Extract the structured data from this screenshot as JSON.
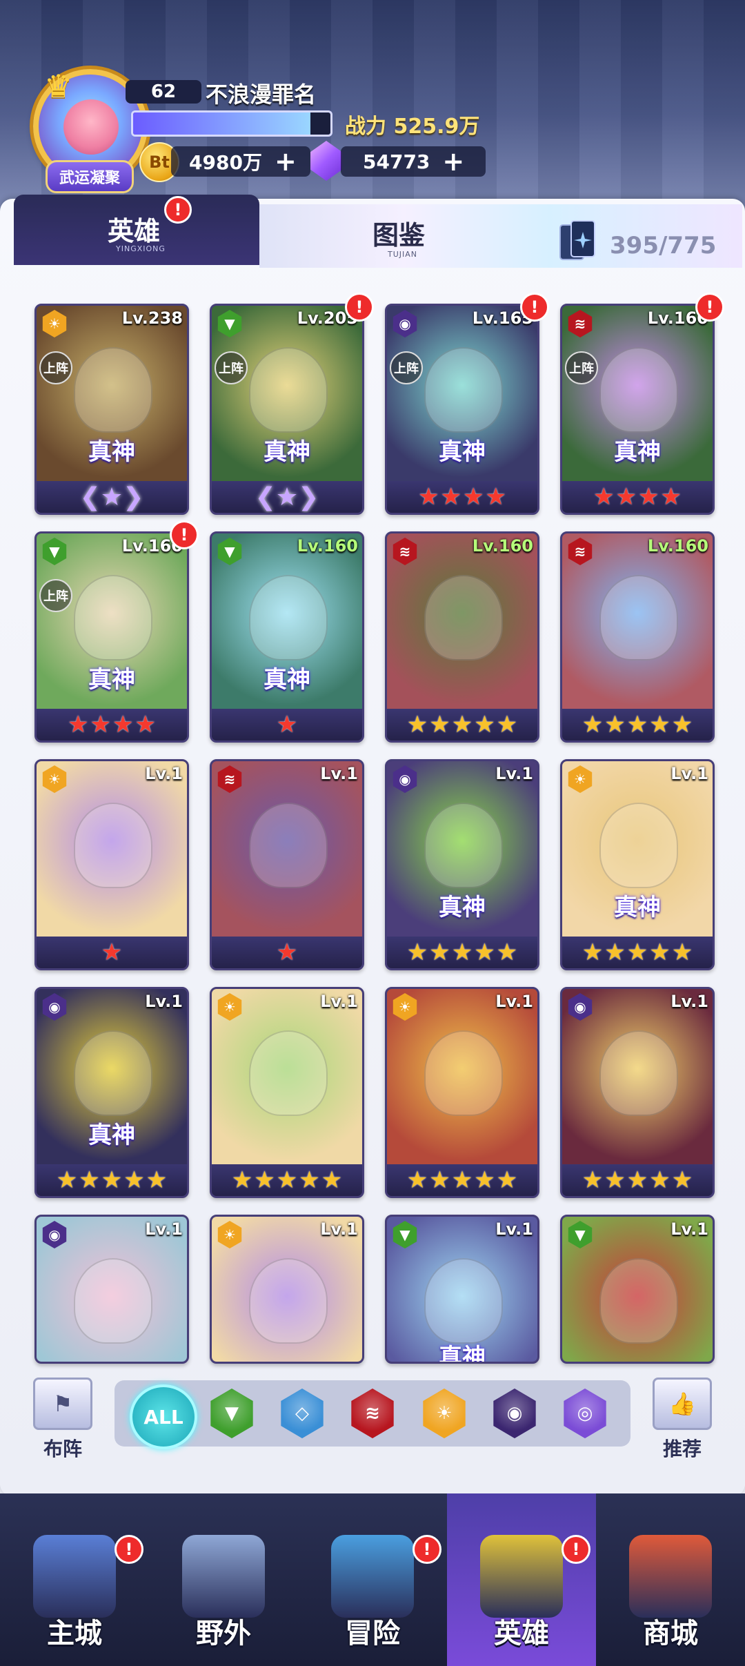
{
  "header": {
    "level": "62",
    "player_name": "不浪漫罪名",
    "exp_progress": 0.9,
    "power_label": "战力",
    "power_value": "525.9万",
    "avatar_badge": "武运凝聚",
    "coin_symbol": "Bt",
    "coins": "4980万",
    "gems": "54773",
    "plus": "+"
  },
  "tabs": [
    {
      "label": "英雄",
      "sub": "YINGXIONG",
      "active": true
    },
    {
      "label": "图鉴",
      "sub": "TUJIAN",
      "active": false
    }
  ],
  "hero_count": "395/775",
  "god_label": "真神",
  "deploy_label": "上阵",
  "alert": "!",
  "element_glyphs": {
    "light": "☀",
    "nature": "▼",
    "dark": "◉",
    "fire": "≋"
  },
  "colors": {
    "red_star": "#f5392e",
    "gold_star": "#f8c12b",
    "accent": "#6b5cff"
  },
  "heroes": [
    {
      "level": "Lv.238",
      "element": "light",
      "deploy": true,
      "god": true,
      "stars": 0,
      "star_color": "wing",
      "alert": false,
      "level_color": "white",
      "bg": [
        "#6a4a2e",
        "#c7b06a"
      ]
    },
    {
      "level": "Lv.205",
      "element": "nature",
      "deploy": true,
      "god": true,
      "stars": 0,
      "star_color": "wing",
      "alert": true,
      "level_color": "white",
      "bg": [
        "#3c6a3a",
        "#e6d27a"
      ]
    },
    {
      "level": "Lv.165",
      "element": "dark",
      "deploy": true,
      "god": true,
      "stars": 4,
      "star_color": "red",
      "alert": true,
      "level_color": "white",
      "bg": [
        "#3a3a6a",
        "#7fd8d0"
      ]
    },
    {
      "level": "Lv.160",
      "element": "fire",
      "deploy": true,
      "god": true,
      "stars": 4,
      "star_color": "red",
      "alert": true,
      "level_color": "white",
      "bg": [
        "#3b6a3a",
        "#c58be6"
      ]
    },
    {
      "level": "Lv.160",
      "element": "nature",
      "deploy": true,
      "god": true,
      "stars": 4,
      "star_color": "red",
      "alert": true,
      "level_color": "white",
      "bg": [
        "#6fa95c",
        "#e9d7b4"
      ]
    },
    {
      "level": "Lv.160",
      "element": "nature",
      "deploy": false,
      "god": true,
      "stars": 1,
      "star_color": "red",
      "alert": false,
      "level_color": "green",
      "bg": [
        "#3d7b6a",
        "#9fe1f2"
      ]
    },
    {
      "level": "Lv.160",
      "element": "fire",
      "deploy": false,
      "god": false,
      "stars": 5,
      "star_color": "gold",
      "alert": false,
      "level_color": "green",
      "bg": [
        "#a4515a",
        "#5b7a3a"
      ]
    },
    {
      "level": "Lv.160",
      "element": "fire",
      "deploy": false,
      "god": false,
      "stars": 5,
      "star_color": "gold",
      "alert": false,
      "level_color": "green",
      "bg": [
        "#b05a63",
        "#7fb3f0"
      ]
    },
    {
      "level": "Lv.1",
      "element": "light",
      "deploy": false,
      "god": false,
      "stars": 1,
      "star_color": "red",
      "alert": false,
      "level_color": "white",
      "bg": [
        "#f1d9a6",
        "#b38de6"
      ]
    },
    {
      "level": "Lv.1",
      "element": "fire",
      "deploy": false,
      "god": false,
      "stars": 1,
      "star_color": "red",
      "alert": false,
      "level_color": "white",
      "bg": [
        "#a5535e",
        "#6b5aa8"
      ]
    },
    {
      "level": "Lv.1",
      "element": "dark",
      "deploy": false,
      "god": true,
      "stars": 5,
      "star_color": "gold",
      "alert": false,
      "level_color": "white",
      "bg": [
        "#4b3e7a",
        "#8ad64a"
      ]
    },
    {
      "level": "Lv.1",
      "element": "light",
      "deploy": false,
      "god": true,
      "stars": 5,
      "star_color": "gold",
      "alert": false,
      "level_color": "white",
      "bg": [
        "#f2d7a8",
        "#e8c67a"
      ]
    },
    {
      "level": "Lv.1",
      "element": "dark",
      "deploy": false,
      "god": true,
      "stars": 5,
      "star_color": "gold",
      "alert": false,
      "level_color": "white",
      "bg": [
        "#33305c",
        "#e6cf3a"
      ]
    },
    {
      "level": "Lv.1",
      "element": "light",
      "deploy": false,
      "god": false,
      "stars": 5,
      "star_color": "gold",
      "alert": false,
      "level_color": "white",
      "bg": [
        "#f0d9a6",
        "#a8d67a"
      ]
    },
    {
      "level": "Lv.1",
      "element": "light",
      "deploy": false,
      "god": false,
      "stars": 5,
      "star_color": "gold",
      "alert": false,
      "level_color": "white",
      "bg": [
        "#b54a3a",
        "#f0c04a"
      ]
    },
    {
      "level": "Lv.1",
      "element": "dark",
      "deploy": false,
      "god": false,
      "stars": 5,
      "star_color": "gold",
      "alert": false,
      "level_color": "white",
      "bg": [
        "#6a2a3e",
        "#f1d06a"
      ]
    },
    {
      "level": "Lv.1",
      "element": "dark",
      "deploy": false,
      "god": false,
      "stars": 0,
      "star_color": "gold",
      "alert": false,
      "level_color": "white",
      "bg": [
        "#9fc7d6",
        "#f1c0d6"
      ]
    },
    {
      "level": "Lv.1",
      "element": "light",
      "deploy": false,
      "god": false,
      "stars": 0,
      "star_color": "gold",
      "alert": false,
      "level_color": "white",
      "bg": [
        "#f1d9a6",
        "#b38de6"
      ]
    },
    {
      "level": "Lv.1",
      "element": "nature",
      "deploy": false,
      "god": true,
      "stars": 0,
      "star_color": "gold",
      "alert": false,
      "level_color": "white",
      "bg": [
        "#5a5aa0",
        "#9fd6f2"
      ]
    },
    {
      "level": "Lv.1",
      "element": "nature",
      "deploy": false,
      "god": false,
      "stars": 0,
      "star_color": "gold",
      "alert": false,
      "level_color": "white",
      "bg": [
        "#7fa84a",
        "#c93a3a"
      ]
    }
  ],
  "filter": {
    "left_button": "布阵",
    "right_button": "推荐",
    "all_label": "ALL",
    "elements": [
      {
        "name": "nature",
        "color": "#3f9f2d",
        "glyph": "▼"
      },
      {
        "name": "water",
        "color": "#3a8fd6",
        "glyph": "◇"
      },
      {
        "name": "fire",
        "color": "#b7161f",
        "glyph": "≋"
      },
      {
        "name": "light",
        "color": "#f0a522",
        "glyph": "☀"
      },
      {
        "name": "dark",
        "color": "#3b2670",
        "glyph": "◉"
      },
      {
        "name": "arcane",
        "color": "#7b4cd6",
        "glyph": "◎"
      }
    ]
  },
  "nav": [
    {
      "label": "主城",
      "alert": true,
      "active": false
    },
    {
      "label": "野外",
      "alert": false,
      "active": false
    },
    {
      "label": "冒险",
      "alert": true,
      "active": false
    },
    {
      "label": "英雄",
      "alert": true,
      "active": true
    },
    {
      "label": "商城",
      "alert": false,
      "active": false
    }
  ]
}
